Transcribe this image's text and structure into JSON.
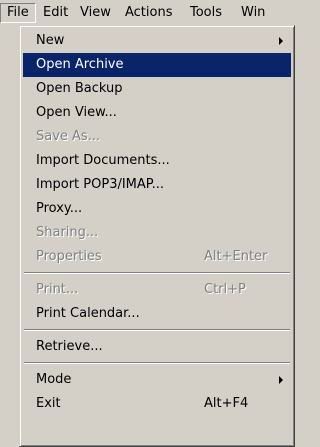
{
  "menubar": {
    "items": [
      {
        "label": "File"
      },
      {
        "label": "Edit"
      },
      {
        "label": "View"
      },
      {
        "label": "Actions"
      },
      {
        "label": "Tools"
      },
      {
        "label": "Win"
      }
    ]
  },
  "file_menu": {
    "items": [
      {
        "label": "New",
        "shortcut": "",
        "state": "normal",
        "submenu": true
      },
      {
        "label": "Open Archive",
        "shortcut": "",
        "state": "selected",
        "submenu": false
      },
      {
        "label": "Open Backup",
        "shortcut": "",
        "state": "normal",
        "submenu": false
      },
      {
        "label": "Open View...",
        "shortcut": "",
        "state": "normal",
        "submenu": false
      },
      {
        "label": "Save As...",
        "shortcut": "",
        "state": "disabled",
        "submenu": false
      },
      {
        "label": "Import Documents...",
        "shortcut": "",
        "state": "normal",
        "submenu": false
      },
      {
        "label": "Import POP3/IMAP...",
        "shortcut": "",
        "state": "normal",
        "submenu": false
      },
      {
        "label": "Proxy...",
        "shortcut": "",
        "state": "normal",
        "submenu": false
      },
      {
        "label": "Sharing...",
        "shortcut": "",
        "state": "disabled",
        "submenu": false
      },
      {
        "label": "Properties",
        "shortcut": "Alt+Enter",
        "state": "disabled",
        "submenu": false
      },
      {
        "label": "Print...",
        "shortcut": "Ctrl+P",
        "state": "disabled",
        "submenu": false
      },
      {
        "label": "Print Calendar...",
        "shortcut": "",
        "state": "normal",
        "submenu": false
      },
      {
        "label": "Retrieve...",
        "shortcut": "",
        "state": "normal",
        "submenu": false
      },
      {
        "label": "Mode",
        "shortcut": "",
        "state": "normal",
        "submenu": true
      },
      {
        "label": "Exit",
        "shortcut": "Alt+F4",
        "state": "normal",
        "submenu": false
      }
    ]
  },
  "colors": {
    "highlight": "#0a246a",
    "face": "#d4d0c8",
    "disabled_text": "#808080"
  }
}
